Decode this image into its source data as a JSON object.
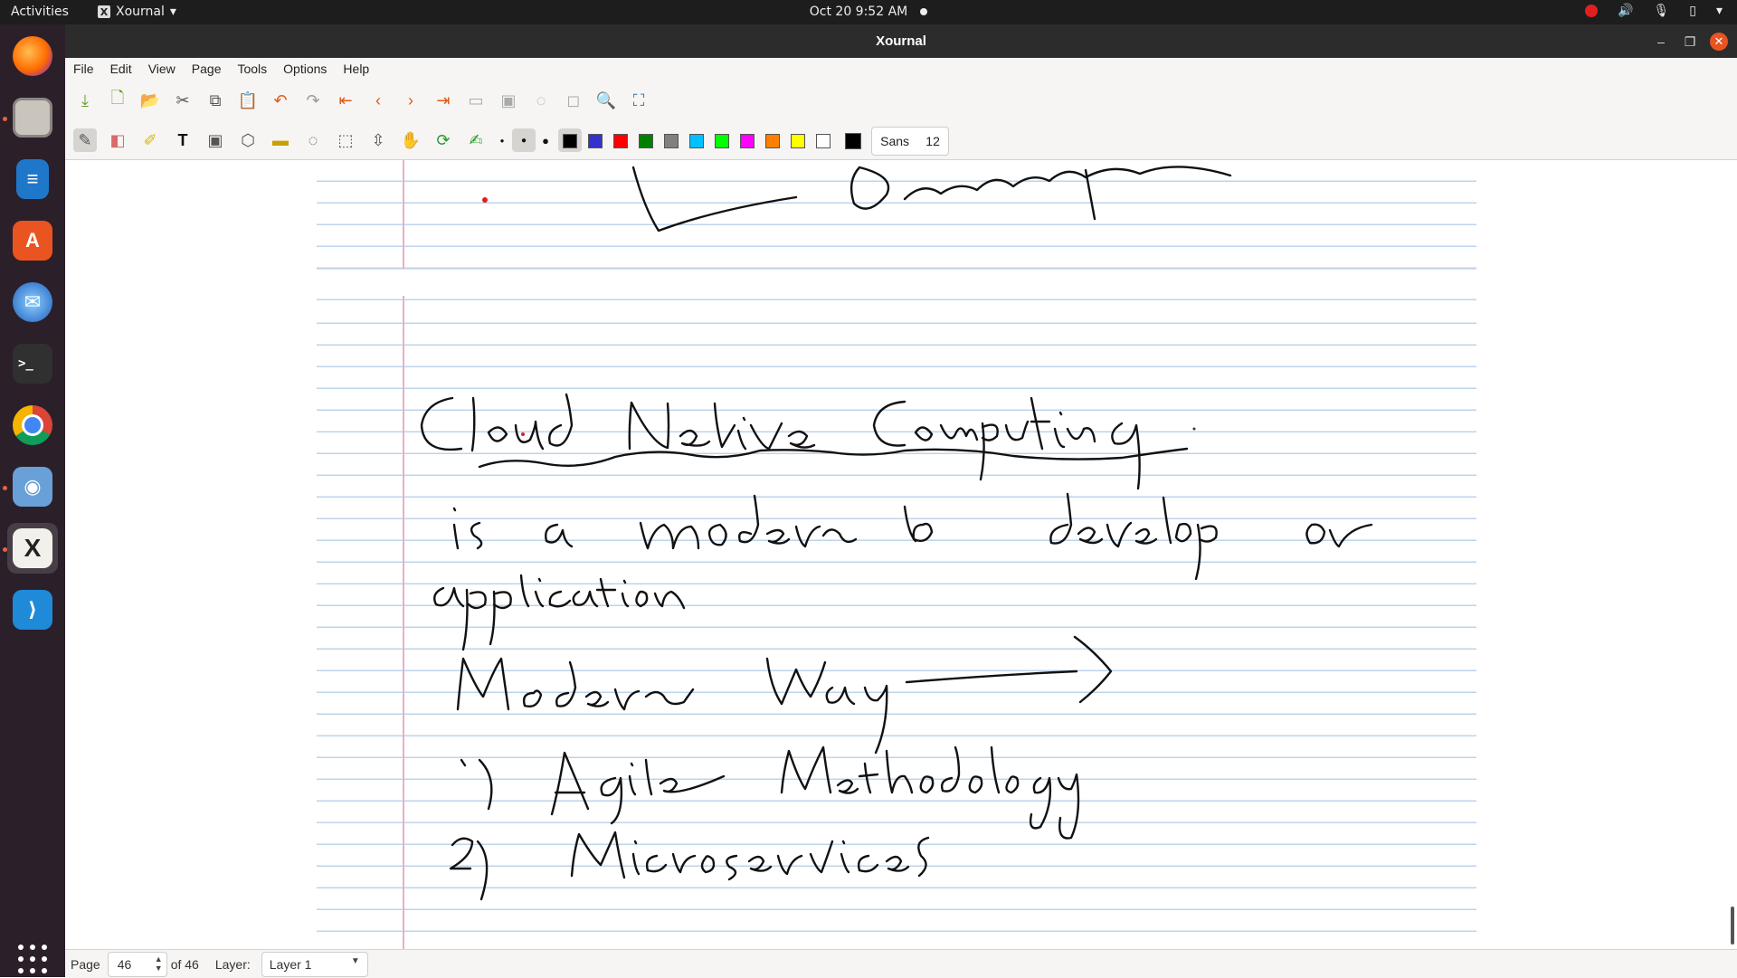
{
  "topbar": {
    "activities": "Activities",
    "app_name": "Xournal",
    "clock": "Oct 20  9:52 AM"
  },
  "dock": {
    "apps": [
      "Firefox",
      "Files",
      "LibreOffice Writer",
      "Ubuntu Software",
      "Thunderbird",
      "Terminal",
      "Google Chrome",
      "Screenshot",
      "Xournal",
      "Visual Studio Code"
    ],
    "show_apps": "Show Applications"
  },
  "window": {
    "title": "Xournal"
  },
  "menu": {
    "file": "File",
    "edit": "Edit",
    "view": "View",
    "page": "Page",
    "tools": "Tools",
    "options": "Options",
    "help": "Help"
  },
  "toolbar": {
    "font_name": "Sans",
    "font_size": "12",
    "colors": [
      {
        "name": "black",
        "hex": "#000000"
      },
      {
        "name": "blue",
        "hex": "#3333cc"
      },
      {
        "name": "red",
        "hex": "#ff0000"
      },
      {
        "name": "green",
        "hex": "#008000"
      },
      {
        "name": "gray",
        "hex": "#808080"
      },
      {
        "name": "light-blue",
        "hex": "#00c0ff"
      },
      {
        "name": "light-green",
        "hex": "#00ff00"
      },
      {
        "name": "magenta",
        "hex": "#ff00ff"
      },
      {
        "name": "orange",
        "hex": "#ff8000"
      },
      {
        "name": "yellow",
        "hex": "#ffff00"
      },
      {
        "name": "white",
        "hex": "#ffffff"
      },
      {
        "name": "selected",
        "hex": "#000000"
      }
    ]
  },
  "status": {
    "page_label": "Page",
    "page_value": "46",
    "of_label": "of 46",
    "layer_label": "Layer:",
    "layer_value": "Layer 1"
  }
}
